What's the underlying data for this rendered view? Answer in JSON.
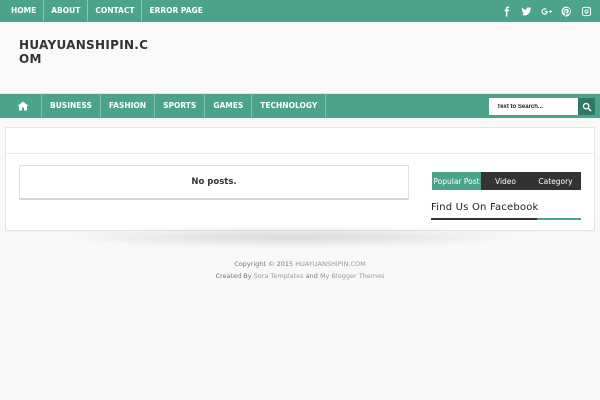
{
  "topbar": {
    "links": [
      "HOME",
      "ABOUT",
      "CONTACT",
      "ERROR PAGE"
    ],
    "social": [
      "facebook-icon",
      "twitter-icon",
      "google-plus-icon",
      "pinterest-icon",
      "instagram-icon"
    ]
  },
  "header": {
    "title": "HUAYUANSHIPIN.COM"
  },
  "nav": {
    "items": [
      "BUSINESS",
      "FASHION",
      "SPORTS",
      "GAMES",
      "TECHNOLOGY"
    ],
    "search_placeholder": "Text to Search..."
  },
  "main": {
    "empty_message": "No posts."
  },
  "sidebar": {
    "tabs": [
      "Popular Post",
      "Video",
      "Category"
    ],
    "facebook_title": "Find Us On Facebook"
  },
  "footer": {
    "copyright_prefix": "Copyright © 2015",
    "site_link": "HUAYUANSHIPIN.COM",
    "created_by": "Created By",
    "sora_link": "Sora Templates",
    "and": "and",
    "blogger_link": "My Blogger Themes"
  },
  "colors": {
    "accent": "#4aa38a",
    "dark": "#333333",
    "page": "#f8f8f8"
  }
}
